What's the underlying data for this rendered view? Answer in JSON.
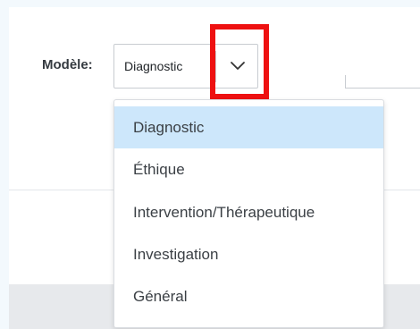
{
  "form": {
    "model_label": "Modèle:",
    "selected_value": "Diagnostic"
  },
  "dropdown": {
    "options": [
      {
        "label": "Diagnostic",
        "selected": true
      },
      {
        "label": "Éthique",
        "selected": false
      },
      {
        "label": "Intervention/Thérapeutique",
        "selected": false
      },
      {
        "label": "Investigation",
        "selected": false
      },
      {
        "label": "Général",
        "selected": false
      }
    ]
  },
  "colors": {
    "highlight": "#ee1111",
    "selected_option_bg": "#cde7fb",
    "page_bg": "#f3f9fd"
  },
  "icons": {
    "dropdown_toggle": "chevron-down-icon"
  }
}
